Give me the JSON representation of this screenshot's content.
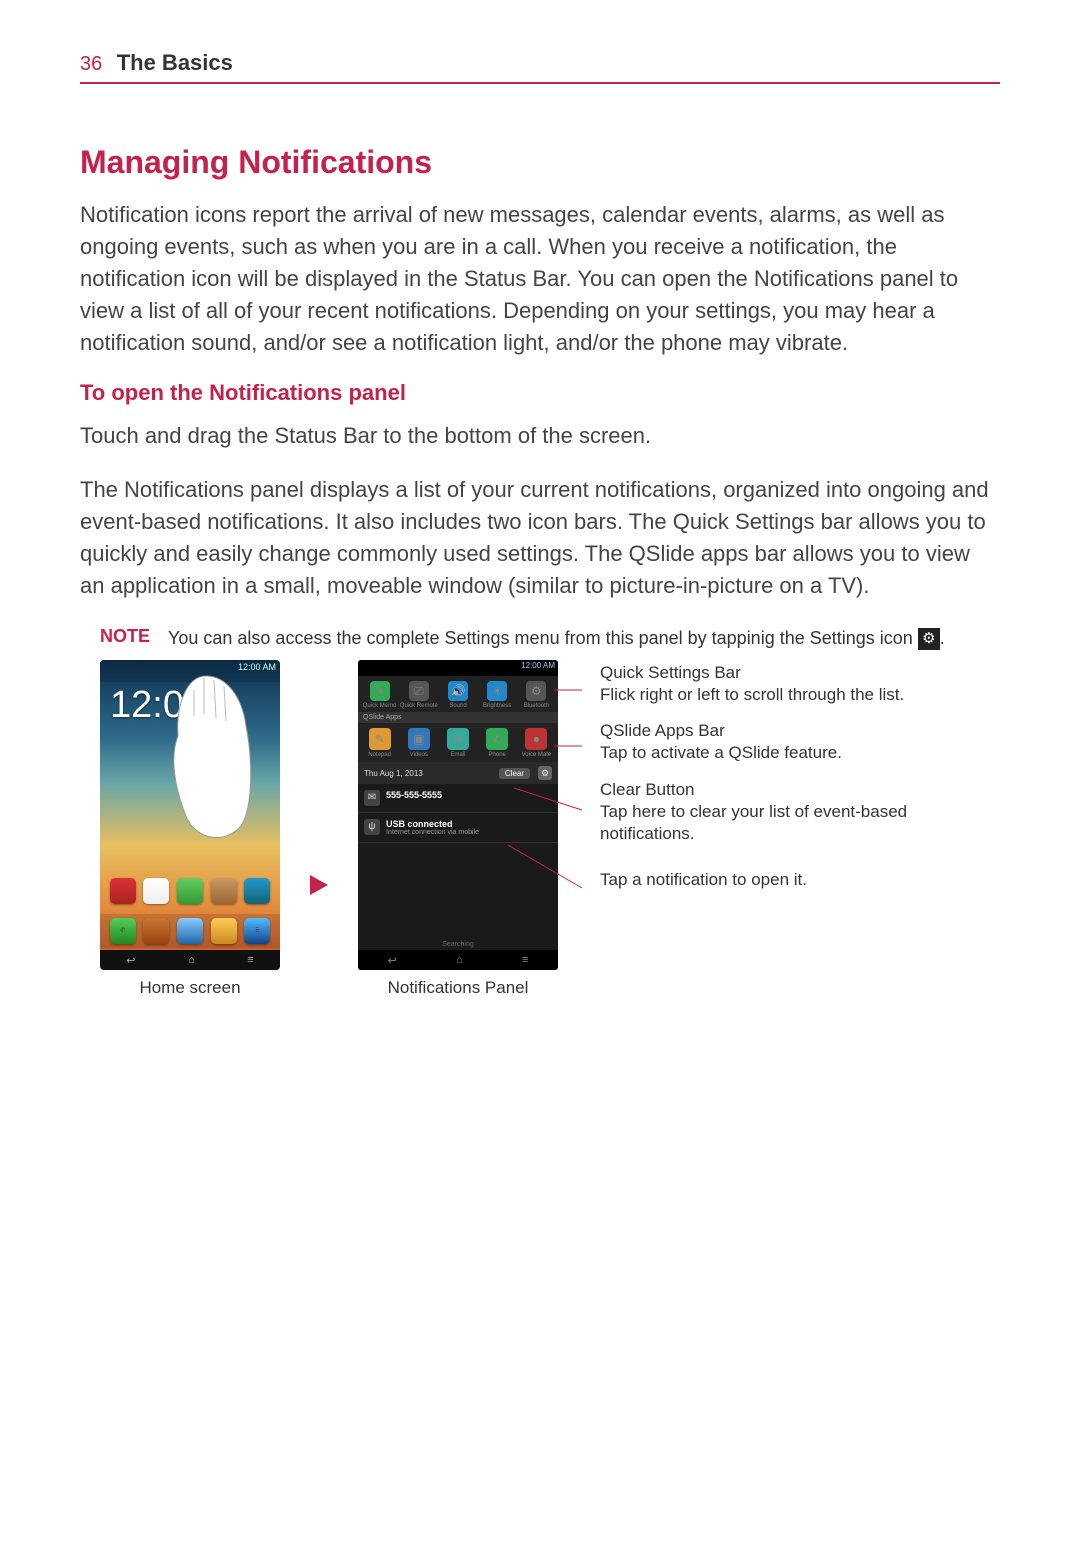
{
  "header": {
    "page_number": "36",
    "chapter": "The Basics"
  },
  "h1": "Managing Notifications",
  "intro": "Notification icons report the arrival of new messages, calendar events, alarms, as well as ongoing events, such as when you are in a call. When you receive a notification, the notification icon will be displayed in the Status Bar. You can open the Notifications panel to view a list of all of your recent notifications. Depending on your settings, you may hear a notification sound, and/or see a notification light, and/or the phone may vibrate.",
  "h2": "To open the Notifications panel",
  "p2": "Touch and drag the Status Bar to the bottom of the screen.",
  "p3": "The Notifications panel displays a list of your current notifications, organized into ongoing and event-based notifications. It also includes two icon bars. The Quick Settings bar allows you to quickly and easily change commonly used settings. The QSlide apps bar allows you to view an application in a small, moveable window (similar to picture-in-picture on a TV).",
  "note": {
    "label": "NOTE",
    "text_before": "You can also access the complete Settings menu from this panel by tappinig the Settings icon ",
    "text_after": "."
  },
  "home": {
    "status": "12:00 AM",
    "clock": "12:00",
    "caption": "Home screen"
  },
  "panel": {
    "status": "12:00 AM",
    "qs": {
      "items": [
        "Quick Memo",
        "Quick Remote",
        "Sound",
        "Brightness",
        "Bluetooth"
      ]
    },
    "qslide_label": "QSlide Apps",
    "qslide": {
      "items": [
        "Notepad",
        "Videos",
        "Email",
        "Phone",
        "Voice Mate"
      ]
    },
    "date": "Thu Aug 1, 2013",
    "clear_label": "Clear",
    "notif1": {
      "title": "555-555-5555",
      "sub": ""
    },
    "notif2": {
      "title": "USB connected",
      "sub": "Internet connection via mobile"
    },
    "carrier": "Searching",
    "caption": "Notifications Panel"
  },
  "callouts": {
    "c1": {
      "title": "Quick Settings Bar",
      "sub": "Flick right or left to scroll through the list."
    },
    "c2": {
      "title": "QSlide Apps Bar",
      "sub": "Tap to activate a QSlide feature."
    },
    "c3": {
      "title": "Clear Button",
      "sub": "Tap here to clear your list of event-based notifications."
    },
    "c4": {
      "title": "",
      "sub": "Tap a notification to open it."
    }
  }
}
